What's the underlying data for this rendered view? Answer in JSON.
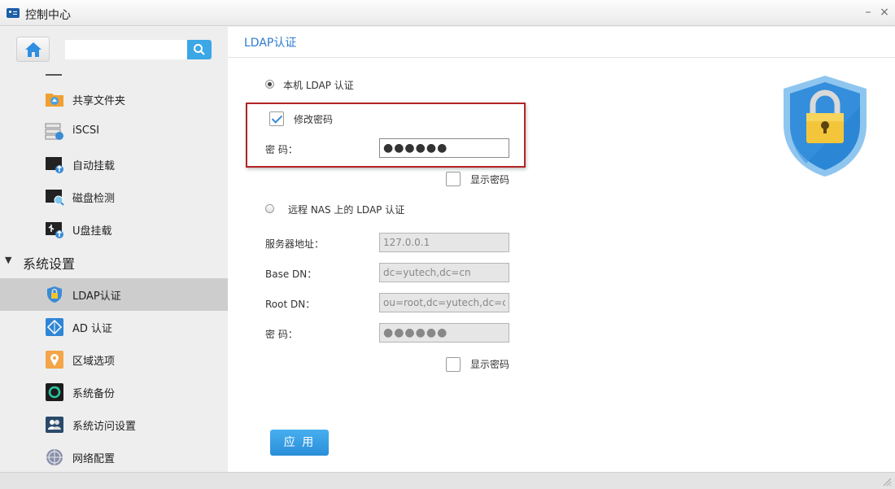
{
  "window": {
    "title": "控制中心",
    "minimize": "–",
    "close": "×"
  },
  "sidebar": {
    "search": {
      "value": "",
      "placeholder": ""
    },
    "items_top": [
      {
        "label": "共享文件夹",
        "icon": "shared-folder-icon"
      },
      {
        "label": "iSCSI",
        "icon": "iscsi-icon"
      },
      {
        "label": "自动挂载",
        "icon": "auto-mount-icon"
      },
      {
        "label": "磁盘检测",
        "icon": "disk-check-icon"
      },
      {
        "label": "U盘挂载",
        "icon": "usb-mount-icon"
      }
    ],
    "section": {
      "label": "系统设置",
      "arrow": "▼"
    },
    "items_system": [
      {
        "label": "LDAP认证",
        "icon": "ldap-shield-icon",
        "active": true
      },
      {
        "label": "AD 认证",
        "icon": "ad-icon"
      },
      {
        "label": "区域选项",
        "icon": "region-icon"
      },
      {
        "label": "系统备份",
        "icon": "backup-icon"
      },
      {
        "label": "系统访问设置",
        "icon": "access-icon"
      },
      {
        "label": "网络配置",
        "icon": "network-icon"
      }
    ]
  },
  "main": {
    "title": "LDAP认证",
    "local": {
      "radio_label": "本机 LDAP 认证",
      "selected": true,
      "change_password_label": "修改密码",
      "change_password_checked": true,
      "password_label": "密 码：",
      "password_value": "●●●●●●",
      "show_password_label": "显示密码",
      "show_password_checked": false
    },
    "remote": {
      "radio_label": "远程 NAS 上的 LDAP 认证",
      "selected": false,
      "server_label": "服务器地址：",
      "server_value": "127.0.0.1",
      "basedn_label": "Base DN：",
      "basedn_value": "dc=yutech,dc=cn",
      "rootdn_label": "Root DN：",
      "rootdn_value": "ou=root,dc=yutech,dc=cn",
      "password_label": "密 码：",
      "password_value": "●●●●●●",
      "show_password_label": "显示密码",
      "show_password_checked": false
    },
    "apply_label": "应 用"
  },
  "colors": {
    "accent": "#2c7bd0",
    "highlight_border": "#b32424",
    "active_item": "#cdcdcd",
    "apply_button": "#3399e0"
  }
}
